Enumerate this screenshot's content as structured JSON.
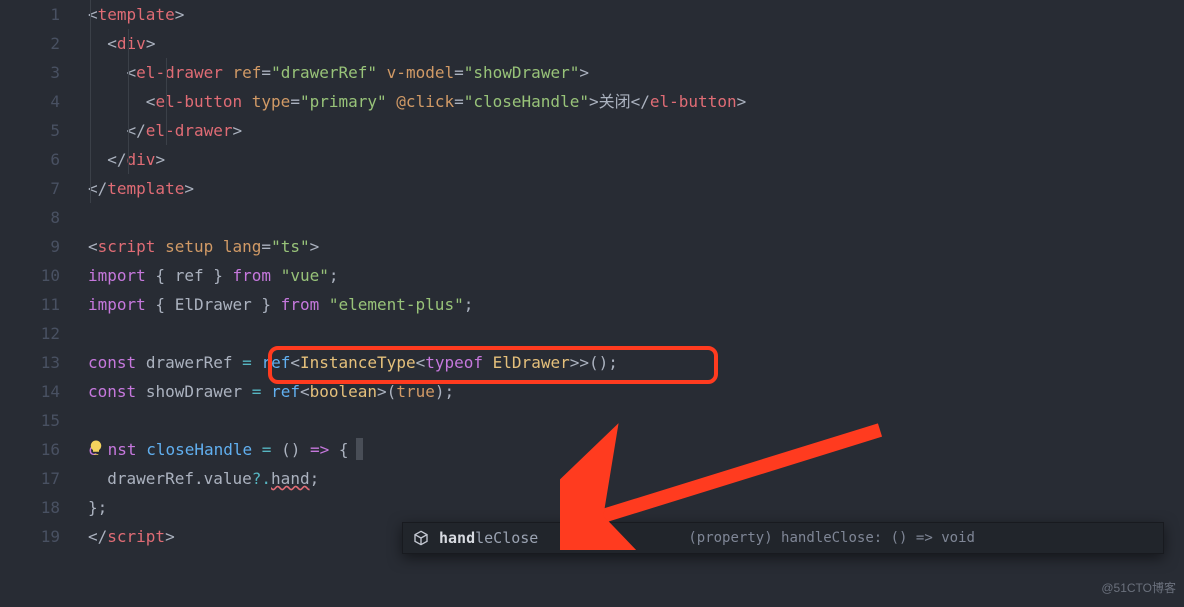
{
  "gutter": {
    "start": 1,
    "end": 19
  },
  "lines": {
    "l1": [
      [
        "p",
        "<"
      ],
      [
        "tg",
        "template"
      ],
      [
        "p",
        ">"
      ]
    ],
    "l2": [
      [
        "p",
        "  <"
      ],
      [
        "tg",
        "div"
      ],
      [
        "p",
        ">"
      ]
    ],
    "l3": [
      [
        "p",
        "    <"
      ],
      [
        "tg",
        "el-drawer"
      ],
      [
        "p",
        " "
      ],
      [
        "at",
        "ref"
      ],
      [
        "p",
        "="
      ],
      [
        "st",
        "\"drawerRef\""
      ],
      [
        "p",
        " "
      ],
      [
        "at",
        "v-model"
      ],
      [
        "p",
        "="
      ],
      [
        "st",
        "\"showDrawer\""
      ],
      [
        "p",
        ">"
      ]
    ],
    "l4": [
      [
        "p",
        "      <"
      ],
      [
        "tg",
        "el-button"
      ],
      [
        "p",
        " "
      ],
      [
        "at",
        "type"
      ],
      [
        "p",
        "="
      ],
      [
        "st",
        "\"primary\""
      ],
      [
        "p",
        " "
      ],
      [
        "at",
        "@click"
      ],
      [
        "p",
        "="
      ],
      [
        "st",
        "\"closeHandle\""
      ],
      [
        "p",
        ">"
      ],
      [
        "tx",
        "关闭"
      ],
      [
        "p",
        "</"
      ],
      [
        "tg",
        "el-button"
      ],
      [
        "p",
        ">"
      ]
    ],
    "l5": [
      [
        "p",
        "    </"
      ],
      [
        "tg",
        "el-drawer"
      ],
      [
        "p",
        ">"
      ]
    ],
    "l6": [
      [
        "p",
        "  </"
      ],
      [
        "tg",
        "div"
      ],
      [
        "p",
        ">"
      ]
    ],
    "l7": [
      [
        "p",
        "</"
      ],
      [
        "tg",
        "template"
      ],
      [
        "p",
        ">"
      ]
    ],
    "l8": [],
    "l9": [
      [
        "p",
        "<"
      ],
      [
        "tg",
        "script"
      ],
      [
        "p",
        " "
      ],
      [
        "at",
        "setup"
      ],
      [
        "p",
        " "
      ],
      [
        "at",
        "lang"
      ],
      [
        "p",
        "="
      ],
      [
        "st",
        "\"ts\""
      ],
      [
        "p",
        ">"
      ]
    ],
    "l10": [
      [
        "kw",
        "import"
      ],
      [
        "p",
        " { "
      ],
      [
        "tx",
        "ref"
      ],
      [
        "p",
        " } "
      ],
      [
        "kw",
        "from"
      ],
      [
        "p",
        " "
      ],
      [
        "st",
        "\"vue\""
      ],
      [
        "p",
        ";"
      ]
    ],
    "l11": [
      [
        "kw",
        "import"
      ],
      [
        "p",
        " { "
      ],
      [
        "tx",
        "ElDrawer"
      ],
      [
        "p",
        " } "
      ],
      [
        "kw",
        "from"
      ],
      [
        "p",
        " "
      ],
      [
        "st",
        "\"element-plus\""
      ],
      [
        "p",
        ";"
      ]
    ],
    "l12": [],
    "l13": [
      [
        "kw",
        "const"
      ],
      [
        "p",
        " "
      ],
      [
        "tx",
        "drawerRef"
      ],
      [
        "p",
        " "
      ],
      [
        "op",
        "="
      ],
      [
        "p",
        " "
      ],
      [
        "fn",
        "ref"
      ],
      [
        "p",
        "<"
      ],
      [
        "ty",
        "InstanceType"
      ],
      [
        "p",
        "<"
      ],
      [
        "kw",
        "typeof"
      ],
      [
        "p",
        " "
      ],
      [
        "ty",
        "ElDrawer"
      ],
      [
        "p",
        ">>();"
      ]
    ],
    "l14": [
      [
        "kw",
        "const"
      ],
      [
        "p",
        " "
      ],
      [
        "tx",
        "showDrawer"
      ],
      [
        "p",
        " "
      ],
      [
        "op",
        "="
      ],
      [
        "p",
        " "
      ],
      [
        "fn",
        "ref"
      ],
      [
        "p",
        "<"
      ],
      [
        "ty",
        "boolean"
      ],
      [
        "p",
        ">("
      ],
      [
        "at",
        "true"
      ],
      [
        "p",
        ");"
      ]
    ],
    "l15": [],
    "l16_a": [
      [
        "kw",
        "c"
      ]
    ],
    "l16_b": [
      [
        "kw",
        "nst"
      ],
      [
        "p",
        " "
      ],
      [
        "fn",
        "closeHandle"
      ],
      [
        "p",
        " "
      ],
      [
        "op",
        "="
      ],
      [
        "p",
        " () "
      ],
      [
        "kw",
        "=>"
      ],
      [
        "p",
        " {"
      ]
    ],
    "l17": [
      [
        "p",
        "  "
      ],
      [
        "tx",
        "drawerRef"
      ],
      [
        "p",
        "."
      ],
      [
        "tx",
        "value"
      ],
      [
        "op",
        "?."
      ]
    ],
    "l17_err": "hand",
    "l17_tail": ";",
    "l18": [
      [
        "p",
        "};"
      ]
    ],
    "l19": [
      [
        "p",
        "</"
      ],
      [
        "tg",
        "script"
      ],
      [
        "p",
        ">"
      ]
    ]
  },
  "highlight": {
    "line": 13
  },
  "bulb": {
    "line": 16
  },
  "completion": {
    "prefix": "hand",
    "suffix": "leClose",
    "detail": "(property) handleClose: () => void"
  },
  "watermark": "@51CTO博客"
}
